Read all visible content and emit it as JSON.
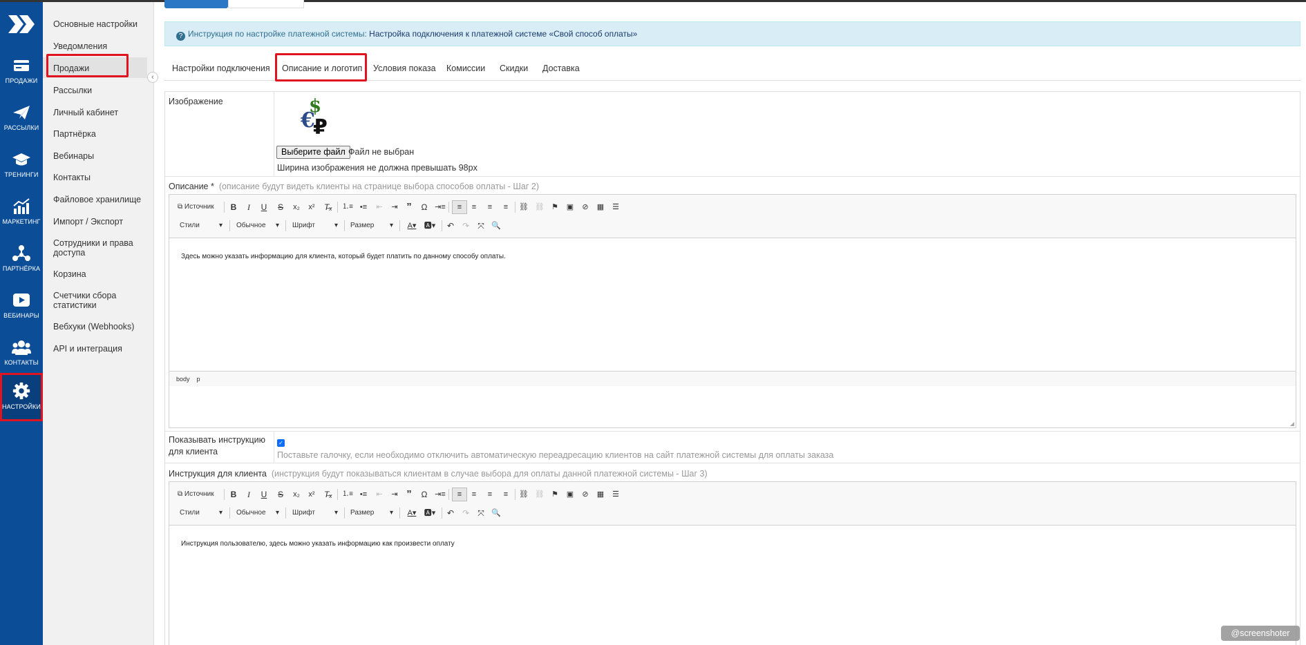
{
  "icon_nav": [
    {
      "icon": "cart-icon",
      "label": "ПРОДАЖИ"
    },
    {
      "icon": "paper-plane-icon",
      "label": "РАССЫЛКИ"
    },
    {
      "icon": "graduation-cap-icon",
      "label": "ТРЕНИНГИ"
    },
    {
      "icon": "bar-chart-icon",
      "label": "МАРКЕТИНГ"
    },
    {
      "icon": "network-icon",
      "label": "ПАРТНЁРКА"
    },
    {
      "icon": "play-icon",
      "label": "ВЕБИНАРЫ"
    },
    {
      "icon": "users-icon",
      "label": "КОНТАКТЫ"
    },
    {
      "icon": "gear-icon",
      "label": "НАСТРОЙКИ",
      "active": true
    }
  ],
  "settings_menu": [
    "Основные настройки",
    "Уведомления",
    "Продажи",
    "Рассылки",
    "Личный кабинет",
    "Партнёрка",
    "Вебинары",
    "Контакты",
    "Файловое хранилище",
    "Импорт / Экспорт",
    "Сотрудники и права доступа",
    "Корзина",
    "Счетчики сбора статистики",
    "Вебхуки (Webhooks)",
    "API и интеграция"
  ],
  "info": {
    "prefix": "Инструкция по настройке платежной системы:",
    "link": "Настройка подключения к платежной системе «Свой способ оплаты»"
  },
  "tabs": [
    "Настройки подключения",
    "Описание и логотип",
    "Условия показа",
    "Комиссии",
    "Скидки",
    "Доставка"
  ],
  "image_field": {
    "label": "Изображение",
    "button": "Выберите файл",
    "no_file": "Файл не выбран",
    "note": "Ширина изображения не должна превышать 98px"
  },
  "description_field": {
    "label": "Описание *",
    "hint": "(описание будут видеть клиенты на странице выбора способов оплаты - Шаг 2)",
    "content": "Здесь можно указать информацию для клиента, который будет платить по данному способу оплаты."
  },
  "toolbar": {
    "source": "Источник",
    "styles": "Стили",
    "format": "Обычное",
    "font": "Шрифт",
    "size": "Размер"
  },
  "pathbar": [
    "body",
    "p"
  ],
  "show_instruction": {
    "label": "Показывать инструкцию для клиента",
    "checked": true,
    "note": "Поставьте галочку, если необходимо отключить автоматическую переадресацию клиентов на сайт платежной системы для оплаты заказа"
  },
  "instruction_field": {
    "label": "Инструкция для клиента",
    "hint": "(инструкция будут показываться клиентам в случае выбора для оплаты данной платежной системы - Шаг 3)",
    "content": "Инструкция пользователю, здесь можно указать информацию как произвести оплату"
  },
  "watermark": "@screenshoter",
  "colors": {
    "nav_bg": "#0b4d97",
    "highlight": "#e0141e",
    "info_bg": "#d9edf7"
  }
}
